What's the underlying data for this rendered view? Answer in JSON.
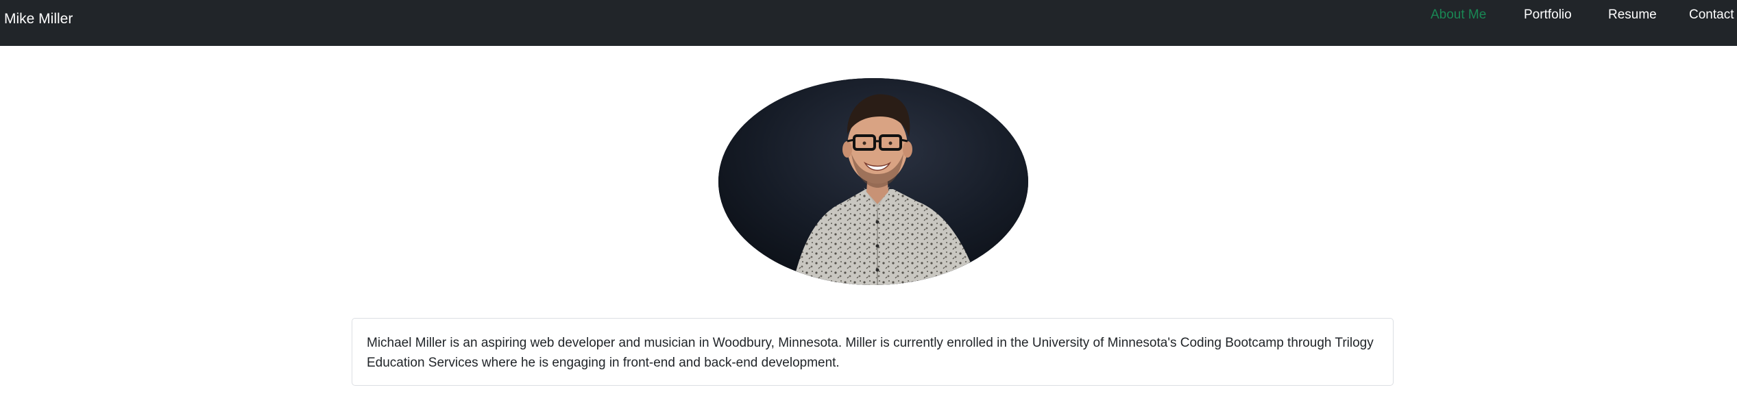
{
  "navbar": {
    "brand": "Mike Miller",
    "links": [
      {
        "label": "About Me",
        "active": true
      },
      {
        "label": "Portfolio",
        "active": false
      },
      {
        "label": "Resume",
        "active": false
      },
      {
        "label": "Contact",
        "active": false
      }
    ]
  },
  "colors": {
    "navbar_bg": "#212529",
    "active_link": "#198754",
    "link": "#ffffff",
    "text": "#212529"
  },
  "profile": {
    "image": "profile-photo"
  },
  "bio": {
    "text": "Michael Miller is an aspiring web developer and musician in Woodbury, Minnesota. Miller is currently enrolled in the University of Minnesota's Coding Bootcamp through Trilogy Education Services where he is engaging in front-end and back-end development."
  }
}
